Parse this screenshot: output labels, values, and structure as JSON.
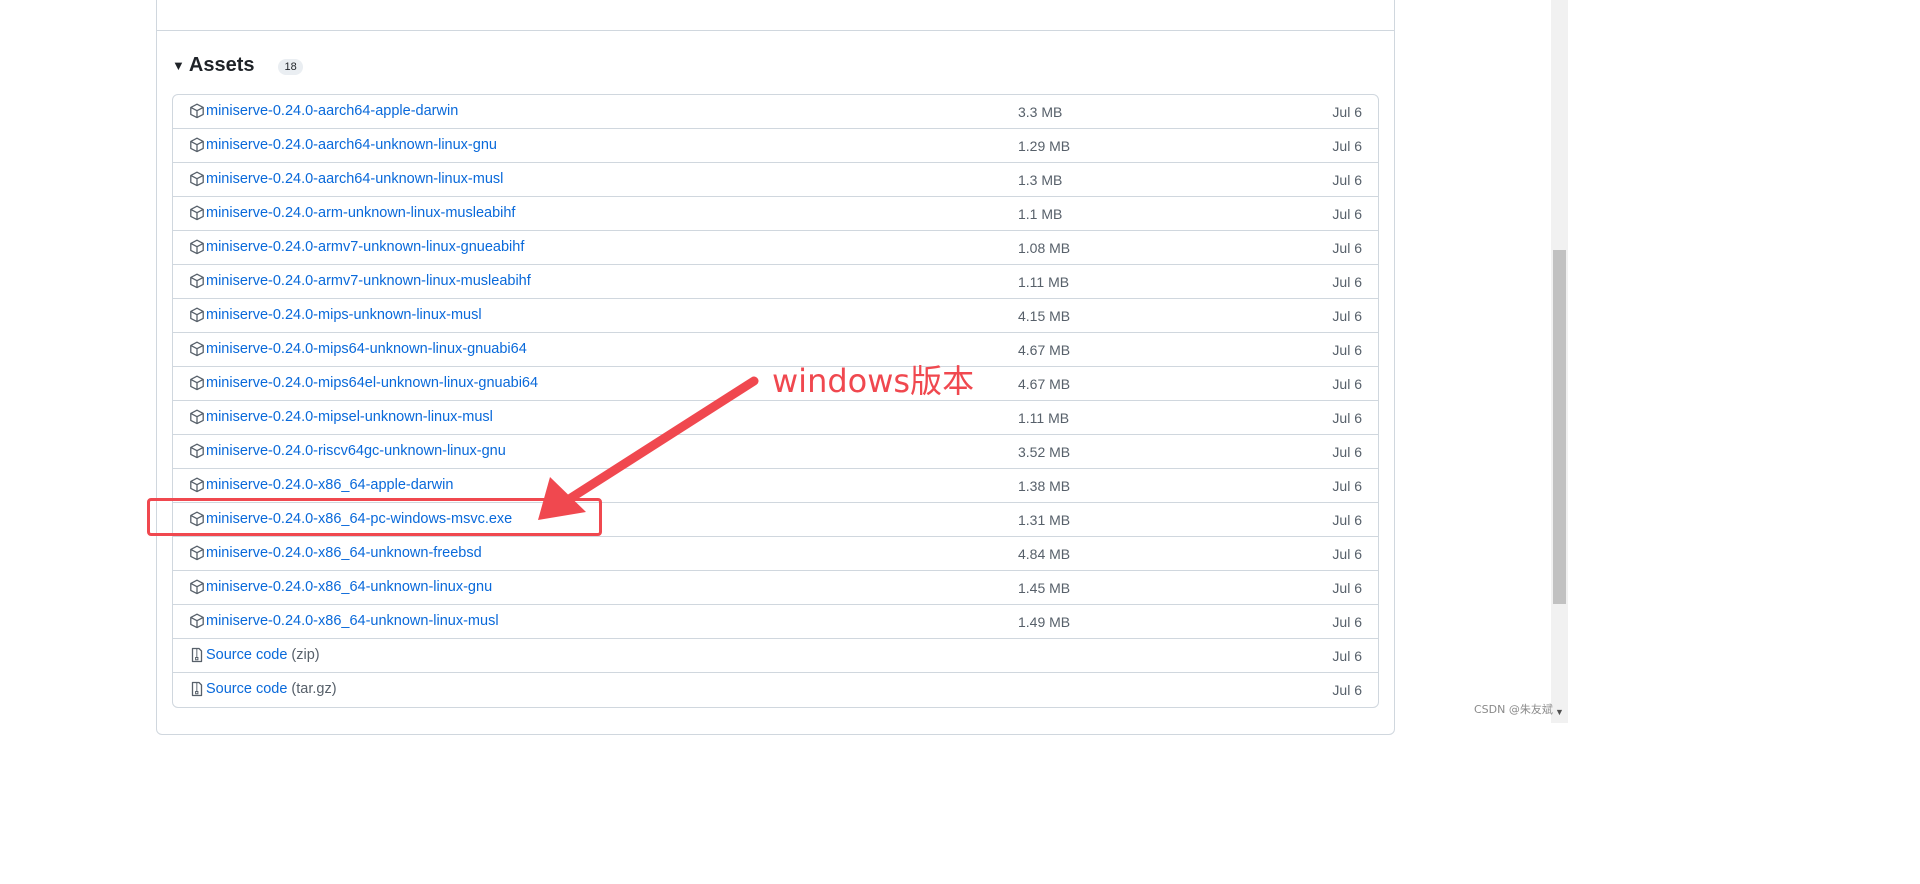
{
  "assets_section": {
    "title": "Assets",
    "count": "18",
    "caret_icon": "triangle-down-icon"
  },
  "assets": [
    {
      "name": "miniserve-0.24.0-aarch64-apple-darwin",
      "ext": "",
      "size": "3.3 MB",
      "date": "Jul 6",
      "icon": "package-icon"
    },
    {
      "name": "miniserve-0.24.0-aarch64-unknown-linux-gnu",
      "ext": "",
      "size": "1.29 MB",
      "date": "Jul 6",
      "icon": "package-icon"
    },
    {
      "name": "miniserve-0.24.0-aarch64-unknown-linux-musl",
      "ext": "",
      "size": "1.3 MB",
      "date": "Jul 6",
      "icon": "package-icon"
    },
    {
      "name": "miniserve-0.24.0-arm-unknown-linux-musleabihf",
      "ext": "",
      "size": "1.1 MB",
      "date": "Jul 6",
      "icon": "package-icon"
    },
    {
      "name": "miniserve-0.24.0-armv7-unknown-linux-gnueabihf",
      "ext": "",
      "size": "1.08 MB",
      "date": "Jul 6",
      "icon": "package-icon"
    },
    {
      "name": "miniserve-0.24.0-armv7-unknown-linux-musleabihf",
      "ext": "",
      "size": "1.11 MB",
      "date": "Jul 6",
      "icon": "package-icon"
    },
    {
      "name": "miniserve-0.24.0-mips-unknown-linux-musl",
      "ext": "",
      "size": "4.15 MB",
      "date": "Jul 6",
      "icon": "package-icon"
    },
    {
      "name": "miniserve-0.24.0-mips64-unknown-linux-gnuabi64",
      "ext": "",
      "size": "4.67 MB",
      "date": "Jul 6",
      "icon": "package-icon"
    },
    {
      "name": "miniserve-0.24.0-mips64el-unknown-linux-gnuabi64",
      "ext": "",
      "size": "4.67 MB",
      "date": "Jul 6",
      "icon": "package-icon"
    },
    {
      "name": "miniserve-0.24.0-mipsel-unknown-linux-musl",
      "ext": "",
      "size": "1.11 MB",
      "date": "Jul 6",
      "icon": "package-icon"
    },
    {
      "name": "miniserve-0.24.0-riscv64gc-unknown-linux-gnu",
      "ext": "",
      "size": "3.52 MB",
      "date": "Jul 6",
      "icon": "package-icon"
    },
    {
      "name": "miniserve-0.24.0-x86_64-apple-darwin",
      "ext": "",
      "size": "1.38 MB",
      "date": "Jul 6",
      "icon": "package-icon"
    },
    {
      "name": "miniserve-0.24.0-x86_64-pc-windows-msvc.exe",
      "ext": "",
      "size": "1.31 MB",
      "date": "Jul 6",
      "icon": "package-icon"
    },
    {
      "name": "miniserve-0.24.0-x86_64-unknown-freebsd",
      "ext": "",
      "size": "4.84 MB",
      "date": "Jul 6",
      "icon": "package-icon"
    },
    {
      "name": "miniserve-0.24.0-x86_64-unknown-linux-gnu",
      "ext": "",
      "size": "1.45 MB",
      "date": "Jul 6",
      "icon": "package-icon"
    },
    {
      "name": "miniserve-0.24.0-x86_64-unknown-linux-musl",
      "ext": "",
      "size": "1.49 MB",
      "date": "Jul 6",
      "icon": "package-icon"
    },
    {
      "name": "Source code",
      "ext": "(zip)",
      "size": "",
      "date": "Jul 6",
      "icon": "file-zip-icon"
    },
    {
      "name": "Source code",
      "ext": "(tar.gz)",
      "size": "",
      "date": "Jul 6",
      "icon": "file-zip-icon"
    }
  ],
  "annotation": {
    "text": "windows版本",
    "color": "#f0484f"
  },
  "watermark": "CSDN @朱友斌",
  "colors": {
    "link": "#0969da",
    "muted": "#57606a",
    "border": "#d0d7de"
  }
}
